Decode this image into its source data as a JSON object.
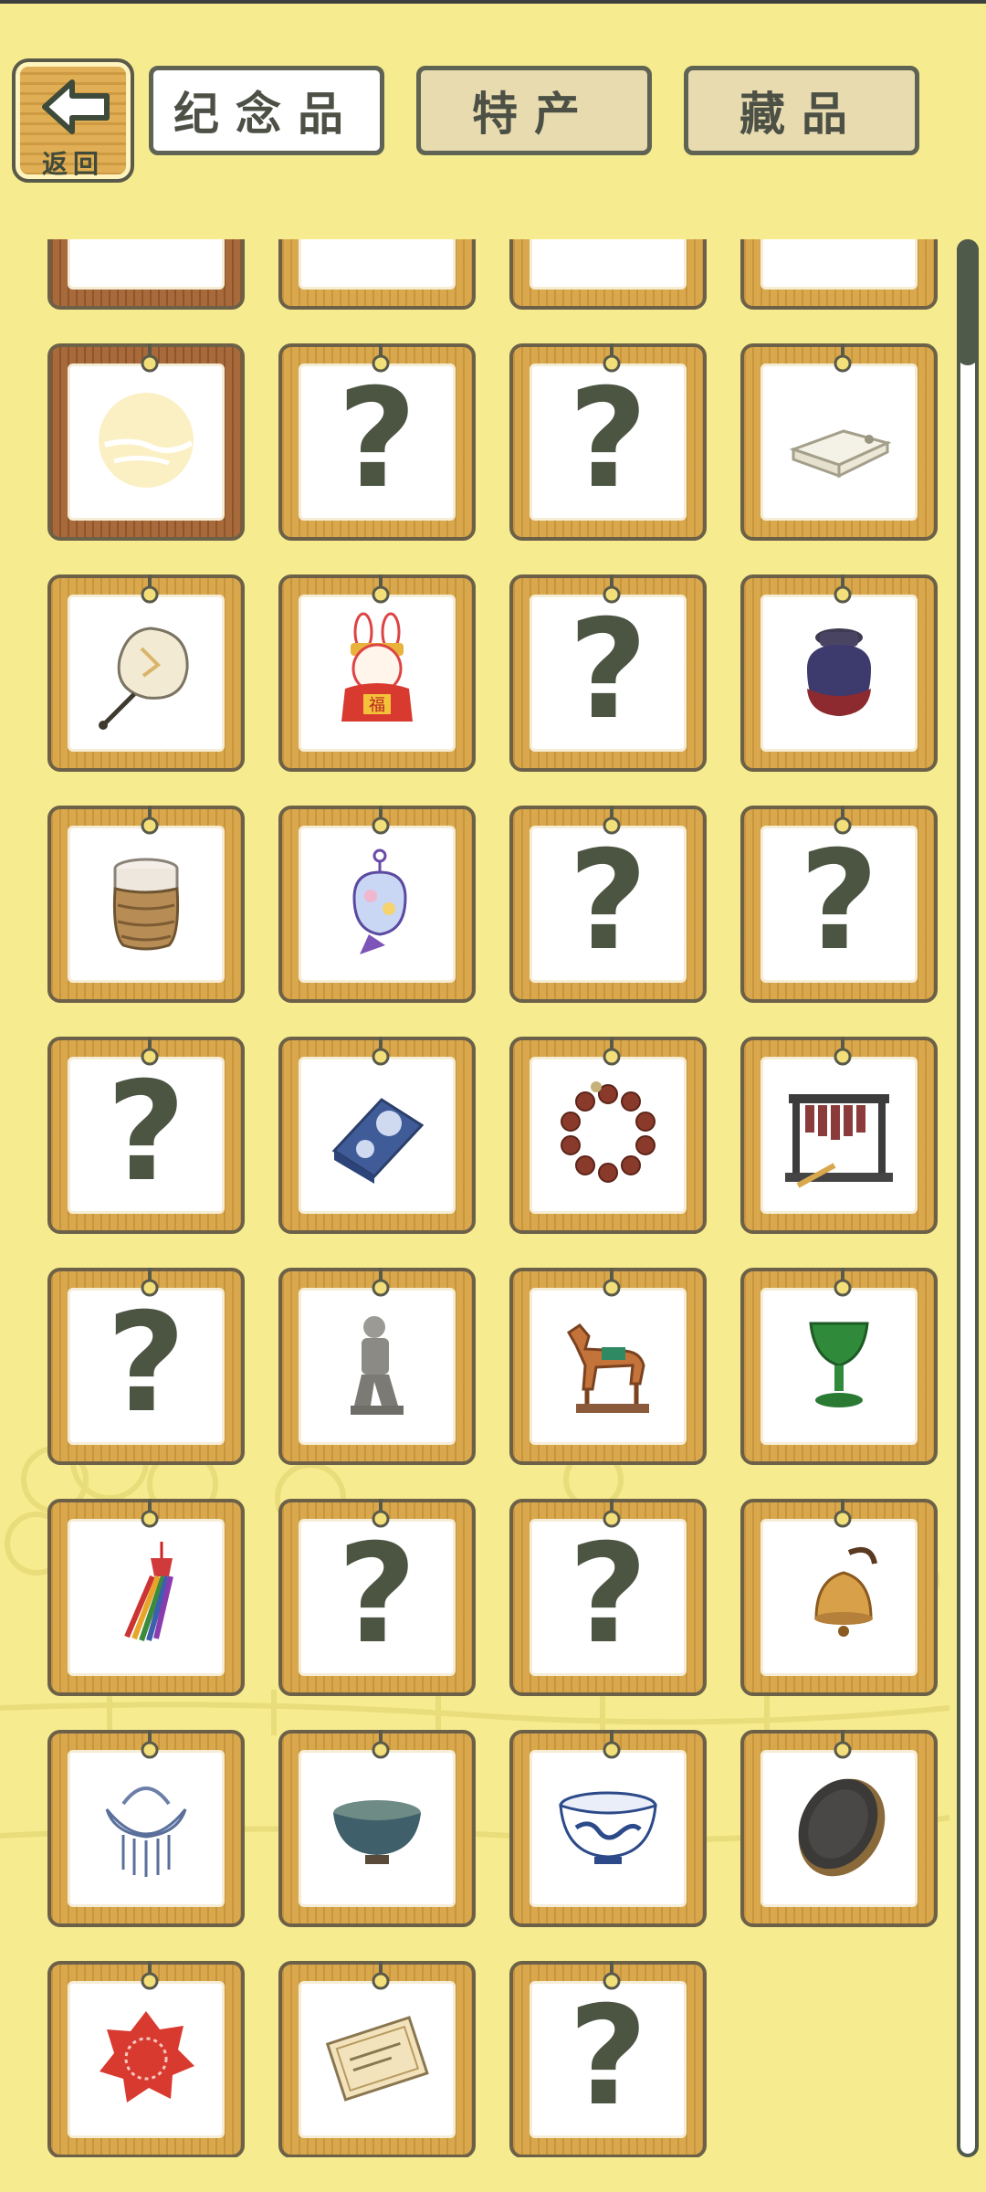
{
  "header": {
    "back_label": "返回",
    "tabs": [
      {
        "label": "纪念品",
        "active": true
      },
      {
        "label": "特产",
        "active": false
      },
      {
        "label": "藏品",
        "active": false
      }
    ]
  },
  "colors": {
    "background": "#f6eb8e",
    "frame_wood": "#d9a84c",
    "frame_selected": "#a86a3a",
    "ink": "#4c5442"
  },
  "grid": {
    "cards": [
      {
        "icon": "moon-icon",
        "unknown": false,
        "selected": true
      },
      {
        "icon": "question-mark-icon",
        "unknown": true
      },
      {
        "icon": "question-mark-icon",
        "unknown": true
      },
      {
        "icon": "folded-silk-icon",
        "unknown": false
      },
      {
        "icon": "round-fan-icon",
        "unknown": false
      },
      {
        "icon": "rabbit-figurine-icon",
        "unknown": false
      },
      {
        "icon": "question-mark-icon",
        "unknown": true
      },
      {
        "icon": "clay-jar-icon",
        "unknown": false
      },
      {
        "icon": "wicker-cup-icon",
        "unknown": false
      },
      {
        "icon": "embroidered-pouch-icon",
        "unknown": false
      },
      {
        "icon": "question-mark-icon",
        "unknown": true
      },
      {
        "icon": "question-mark-icon",
        "unknown": true
      },
      {
        "icon": "question-mark-icon",
        "unknown": true
      },
      {
        "icon": "blue-cloth-icon",
        "unknown": false
      },
      {
        "icon": "prayer-beads-icon",
        "unknown": false
      },
      {
        "icon": "stone-chime-icon",
        "unknown": false
      },
      {
        "icon": "question-mark-icon",
        "unknown": true
      },
      {
        "icon": "terracotta-warrior-icon",
        "unknown": false
      },
      {
        "icon": "tang-horse-icon",
        "unknown": false
      },
      {
        "icon": "jade-cup-icon",
        "unknown": false
      },
      {
        "icon": "knot-tassel-icon",
        "unknown": false
      },
      {
        "icon": "question-mark-icon",
        "unknown": true
      },
      {
        "icon": "question-mark-icon",
        "unknown": true
      },
      {
        "icon": "bronze-bell-icon",
        "unknown": false
      },
      {
        "icon": "silver-lock-icon",
        "unknown": false
      },
      {
        "icon": "tea-bowl-icon",
        "unknown": false
      },
      {
        "icon": "porcelain-bowl-icon",
        "unknown": false
      },
      {
        "icon": "ink-stone-icon",
        "unknown": false
      },
      {
        "icon": "paper-cut-icon",
        "unknown": false
      },
      {
        "icon": "certificate-icon",
        "unknown": false
      },
      {
        "icon": "question-mark-icon",
        "unknown": true
      }
    ],
    "question_glyph": "?"
  },
  "scroll": {
    "position": 0.0
  }
}
